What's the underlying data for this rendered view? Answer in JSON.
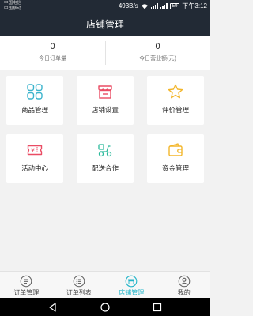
{
  "status_bar": {
    "carrier_1": "中国电信",
    "carrier_2": "中国移动",
    "speed": "493B/s",
    "battery": "59",
    "time": "下午3:12"
  },
  "header": {
    "title": "店铺管理"
  },
  "stats": [
    {
      "value": "0",
      "label": "今日订单量"
    },
    {
      "value": "0",
      "label": "今日营业额(元)"
    }
  ],
  "grid": [
    {
      "label": "商品管理",
      "icon": "product-management-icon",
      "color": "#3ab3cc"
    },
    {
      "label": "店铺设置",
      "icon": "store-settings-icon",
      "color": "#ea4c64"
    },
    {
      "label": "评价管理",
      "icon": "review-star-icon",
      "color": "#f3b62b"
    },
    {
      "label": "活动中心",
      "icon": "activity-ticket-icon",
      "color": "#ea4c64"
    },
    {
      "label": "配送合作",
      "icon": "delivery-scooter-icon",
      "color": "#2bb99b"
    },
    {
      "label": "资金管理",
      "icon": "wallet-icon",
      "color": "#f3b62b"
    }
  ],
  "tabs": [
    {
      "label": "订单管理",
      "icon": "order-management-icon",
      "active": false
    },
    {
      "label": "订单列表",
      "icon": "order-list-icon",
      "active": false
    },
    {
      "label": "店铺管理",
      "icon": "store-icon",
      "active": true
    },
    {
      "label": "我的",
      "icon": "profile-icon",
      "active": false
    }
  ],
  "colors": {
    "header_bg": "#222a35",
    "accent": "#22b5c9",
    "page_bg": "#f2f2f2"
  }
}
